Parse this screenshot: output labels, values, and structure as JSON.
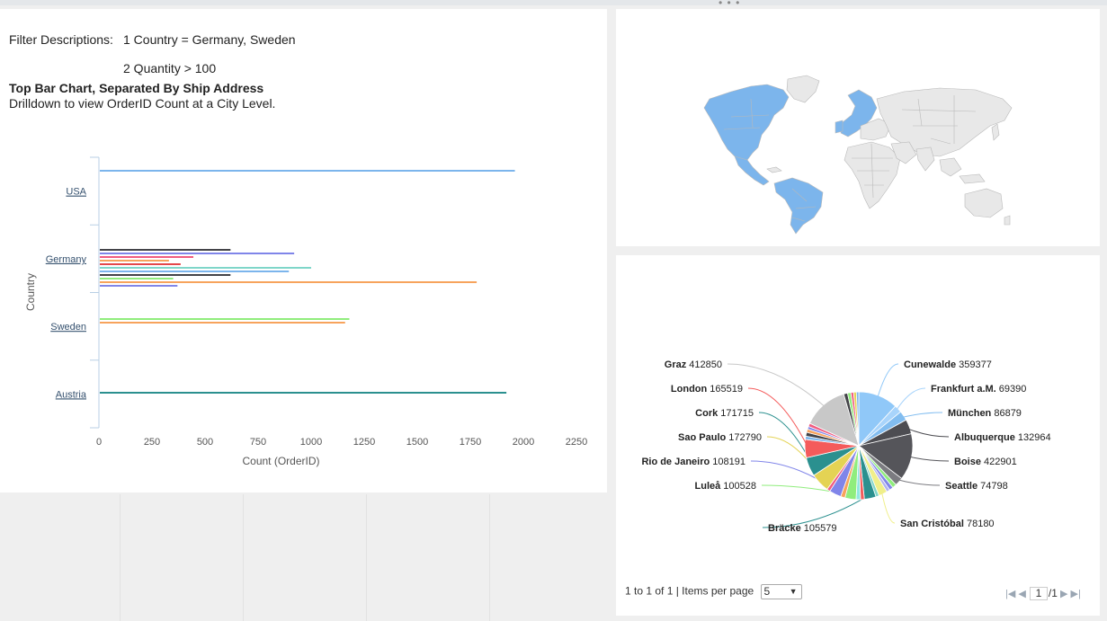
{
  "filters": {
    "label": "Filter Descriptions:",
    "items": [
      "1 Country = Germany, Sweden",
      "2 Quantity > 100"
    ]
  },
  "bar_panel": {
    "title": "Top Bar Chart, Separated By Ship Address",
    "subtitle": "Drilldown to view OrderID Count at a City Level."
  },
  "chart_data": [
    {
      "type": "bar",
      "orientation": "horizontal",
      "xlabel": "Count (OrderID)",
      "ylabel": "Country",
      "xlim": [
        0,
        2250
      ],
      "xticks": [
        0,
        250,
        500,
        750,
        1000,
        1250,
        1500,
        1750,
        2000,
        2250
      ],
      "xtick_labels": [
        "0",
        "250",
        "500",
        "750",
        "1000",
        "1250",
        "1500",
        "1750",
        "2000",
        "2250"
      ],
      "categories": [
        "USA",
        "Germany",
        "Sweden",
        "Austria"
      ],
      "groups": [
        {
          "category": "USA",
          "bars": [
            {
              "value": 1960,
              "color": "#7cb5ec"
            }
          ]
        },
        {
          "category": "Germany",
          "bars": [
            {
              "value": 620,
              "color": "#434348"
            },
            {
              "value": 920,
              "color": "#8085e9"
            },
            {
              "value": 445,
              "color": "#f15c80"
            },
            {
              "value": 330,
              "color": "#f7a35c"
            },
            {
              "value": 385,
              "color": "#e4474a"
            },
            {
              "value": 1000,
              "color": "#7fd6c9"
            },
            {
              "value": 895,
              "color": "#7cb5ec"
            },
            {
              "value": 620,
              "color": "#434348"
            },
            {
              "value": 350,
              "color": "#90ed7d"
            },
            {
              "value": 1780,
              "color": "#f7a35c"
            },
            {
              "value": 370,
              "color": "#8085e9"
            }
          ]
        },
        {
          "category": "Sweden",
          "bars": [
            {
              "value": 1180,
              "color": "#90ed7d"
            },
            {
              "value": 1160,
              "color": "#f7a35c"
            }
          ]
        },
        {
          "category": "Austria",
          "bars": [
            {
              "value": 1920,
              "color": "#2b908f"
            }
          ]
        }
      ]
    },
    {
      "type": "pie",
      "slices": [
        {
          "label": "Cunewalde",
          "value": 359377,
          "color": "#90c8f8"
        },
        {
          "label": "Frankfurt a.M.",
          "value": 69390,
          "color": "#a8d4fb"
        },
        {
          "label": "München",
          "value": 86879,
          "color": "#82bdf0"
        },
        {
          "label": "Albuquerque",
          "value": 132964,
          "color": "#4d4d52"
        },
        {
          "label": "Boise",
          "value": 422901,
          "color": "#55555a"
        },
        {
          "label": "Seattle",
          "value": 74798,
          "color": "#7b7b80"
        },
        {
          "label": "",
          "value": 38000,
          "color": "#90ed7d"
        },
        {
          "label": "",
          "value": 35000,
          "color": "#8085e9"
        },
        {
          "label": "",
          "value": 30000,
          "color": "#b1b3f0"
        },
        {
          "label": "San Cristóbal",
          "value": 78180,
          "color": "#f0ef8a"
        },
        {
          "label": "",
          "value": 30000,
          "color": "#7fd6c9"
        },
        {
          "label": "Bräcke",
          "value": 105579,
          "color": "#2b908f"
        },
        {
          "label": "",
          "value": 35000,
          "color": "#f45b5b"
        },
        {
          "label": "",
          "value": 40000,
          "color": "#91e8e1"
        },
        {
          "label": "Luleå",
          "value": 100528,
          "color": "#90ed7d"
        },
        {
          "label": "",
          "value": 40000,
          "color": "#f7a35c"
        },
        {
          "label": "Rio de Janeiro",
          "value": 108191,
          "color": "#8085e9"
        },
        {
          "label": "",
          "value": 30000,
          "color": "#f15c80"
        },
        {
          "label": "Sao Paulo",
          "value": 172790,
          "color": "#e4d354"
        },
        {
          "label": "Cork",
          "value": 171715,
          "color": "#2b908f"
        },
        {
          "label": "London",
          "value": 165519,
          "color": "#f45b5b"
        },
        {
          "label": "",
          "value": 30000,
          "color": "#7cb5ec"
        },
        {
          "label": "",
          "value": 35000,
          "color": "#434348"
        },
        {
          "label": "",
          "value": 30000,
          "color": "#f7a35c"
        },
        {
          "label": "",
          "value": 25000,
          "color": "#8085e9"
        },
        {
          "label": "",
          "value": 30000,
          "color": "#f15c80"
        },
        {
          "label": "Graz",
          "value": 412850,
          "color": "#c8c8c8"
        },
        {
          "label": "",
          "value": 35000,
          "color": "#434348"
        },
        {
          "label": "",
          "value": 30000,
          "color": "#90ed7d"
        },
        {
          "label": "",
          "value": 25000,
          "color": "#f15c80"
        },
        {
          "label": "",
          "value": 25000,
          "color": "#e4d354"
        },
        {
          "label": "",
          "value": 22000,
          "color": "#7cb5ec"
        }
      ]
    }
  ],
  "map": {
    "highlight_color": "#7cb5ec",
    "base_color": "#e8e8e8",
    "highlighted_regions": [
      "North America",
      "South America",
      "Europe"
    ]
  },
  "pager": {
    "summary": "1 to 1 of 1 | Items per page",
    "items_per_page": "5",
    "page": "1",
    "total": "/1"
  },
  "icons": {
    "first": "first-page-icon",
    "prev": "prev-page-icon",
    "next": "next-page-icon",
    "last": "last-page-icon",
    "dropdown": "chevron-down-icon"
  }
}
